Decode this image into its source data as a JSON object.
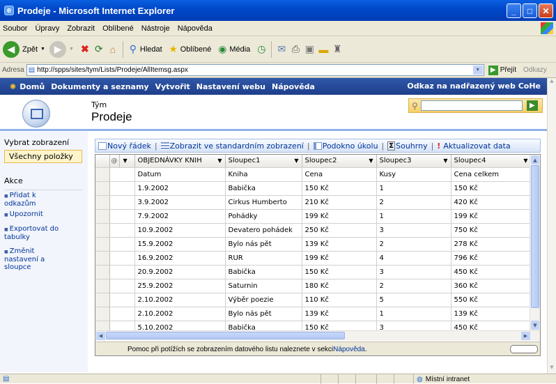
{
  "window": {
    "title": "Prodeje - Microsoft Internet Explorer",
    "logo_letter": "e"
  },
  "menu": [
    "Soubor",
    "Úpravy",
    "Zobrazit",
    "Oblíbené",
    "Nástroje",
    "Nápověda"
  ],
  "toolbar": {
    "back": "Zpět",
    "search": "Hledat",
    "favorites": "Oblíbené",
    "media": "Média"
  },
  "address": {
    "label": "Adresa",
    "url": "http://spps/sites/tym/Lists/Prodeje/AllItemsg.aspx",
    "go": "Přejít",
    "links": "Odkazy"
  },
  "sp_nav": {
    "home": "Domů",
    "items": [
      "Dokumenty a seznamy",
      "Vytvořit",
      "Nastavení webu",
      "Nápověda"
    ],
    "parent_link": "Odkaz na nadřazený web CoHe"
  },
  "header": {
    "team": "Tým",
    "title": "Prodeje"
  },
  "leftnav": {
    "select_view": "Vybrat zobrazení",
    "all_items": "Všechny položky",
    "actions_heading": "Akce",
    "actions": [
      "Přidat k odkazům",
      "Upozornit",
      "Exportovat do tabulky",
      "Změnit nastavení a sloupce"
    ]
  },
  "list_toolbar": {
    "new_row": "Nový řádek",
    "standard_view": "Zobrazit ve standardním zobrazení",
    "task_pane": "Podokno úkolu",
    "totals": "Souhrny",
    "refresh": "Aktualizovat data"
  },
  "grid": {
    "columns": [
      "OBJEDNÁVKY KNIH",
      "Sloupec1",
      "Sloupec2",
      "Sloupec3",
      "Sloupec4"
    ],
    "rows": [
      [
        "Datum",
        "Kniha",
        "Cena",
        "Kusy",
        "Cena celkem"
      ],
      [
        "1.9.2002",
        "Babička",
        "150 Kč",
        "1",
        "150 Kč"
      ],
      [
        "3.9.2002",
        "Cirkus Humberto",
        "210 Kč",
        "2",
        "420 Kč"
      ],
      [
        "7.9.2002",
        "Pohádky",
        "199 Kč",
        "1",
        "199 Kč"
      ],
      [
        "10.9.2002",
        "Devatero pohádek",
        "250 Kč",
        "3",
        "750 Kč"
      ],
      [
        "15.9.2002",
        "Bylo nás pět",
        "139 Kč",
        "2",
        "278 Kč"
      ],
      [
        "16.9.2002",
        "RUR",
        "199 Kč",
        "4",
        "796 Kč"
      ],
      [
        "20.9.2002",
        "Babička",
        "150 Kč",
        "3",
        "450 Kč"
      ],
      [
        "25.9.2002",
        "Saturnin",
        "180 Kč",
        "2",
        "360 Kč"
      ],
      [
        "2.10.2002",
        "Výběr poezie",
        "110 Kč",
        "5",
        "550 Kč"
      ],
      [
        "2.10.2002",
        "Bylo nás pět",
        "139 Kč",
        "1",
        "139 Kč"
      ],
      [
        "5.10.2002",
        "Babička",
        "150 Kč",
        "3",
        "450 Kč"
      ]
    ]
  },
  "help": {
    "text": "Pomoc při potížích se zobrazením datového listu naleznete v sekci ",
    "link": "Nápověda",
    "tail": "."
  },
  "status": {
    "zone": "Místní intranet"
  }
}
